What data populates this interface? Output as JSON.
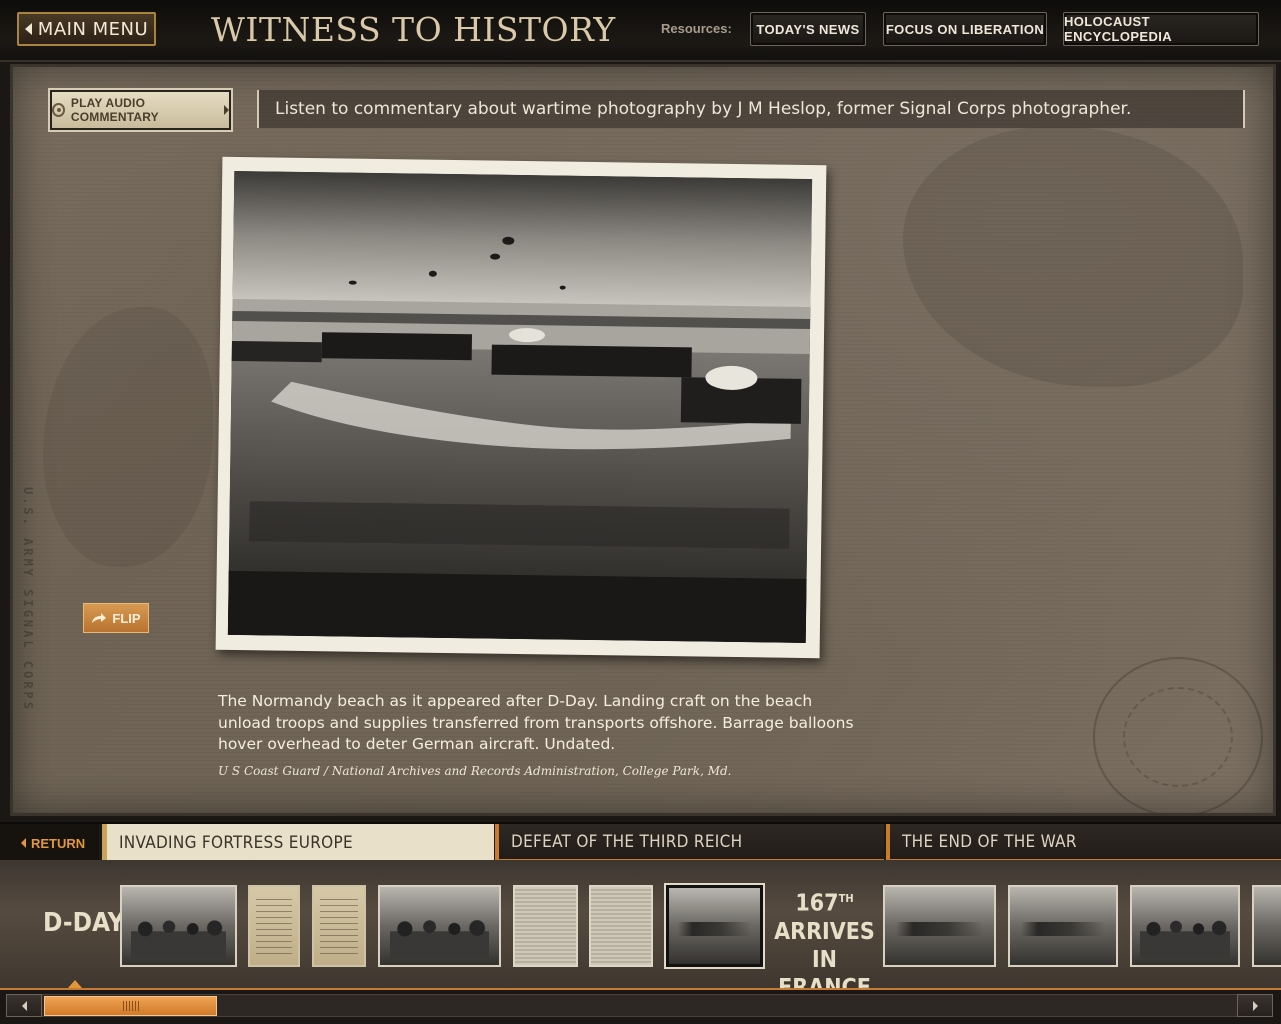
{
  "header": {
    "main_menu_label": "MAIN MENU",
    "title": "WITNESS TO HISTORY",
    "resources_label": "Resources:",
    "resources": [
      {
        "label": "TODAY'S NEWS"
      },
      {
        "label": "FOCUS ON LIBERATION"
      },
      {
        "label": "HOLOCAUST ENCYCLOPEDIA"
      }
    ]
  },
  "audio": {
    "button_label": "PLAY AUDIO COMMENTARY",
    "description": "Listen to commentary about wartime photography by J M Heslop, former Signal Corps photographer."
  },
  "photo": {
    "flip_label": "FLIP",
    "caption": "The Normandy beach as it appeared after D-Day. Landing craft on the beach unload troops and supplies transferred from transports offshore. Barrage balloons hover overhead to deter German aircraft. Undated.",
    "credit": "U S Coast Guard / National Archives and Records Administration, College Park, Md."
  },
  "background": {
    "side_stamp": "U.S. ARMY SIGNAL CORPS"
  },
  "tabs": {
    "return_label": "RETURN",
    "items": [
      {
        "label": "INVADING FORTRESS EUROPE",
        "active": true
      },
      {
        "label": "DEFEAT OF THE THIRD REICH",
        "active": false
      },
      {
        "label": "THE END OF THE WAR",
        "active": false
      }
    ]
  },
  "filmstrip": {
    "section_label": "D-DAY",
    "milestone_number": "167",
    "milestone_suffix": "TH",
    "milestone_text_line1": "ARRIVES IN",
    "milestone_text_line2": "FRANCE"
  },
  "colors": {
    "accent_orange": "#e3973d",
    "active_tab_bg": "#e8e0c8",
    "title_text": "#d9c9a8"
  }
}
